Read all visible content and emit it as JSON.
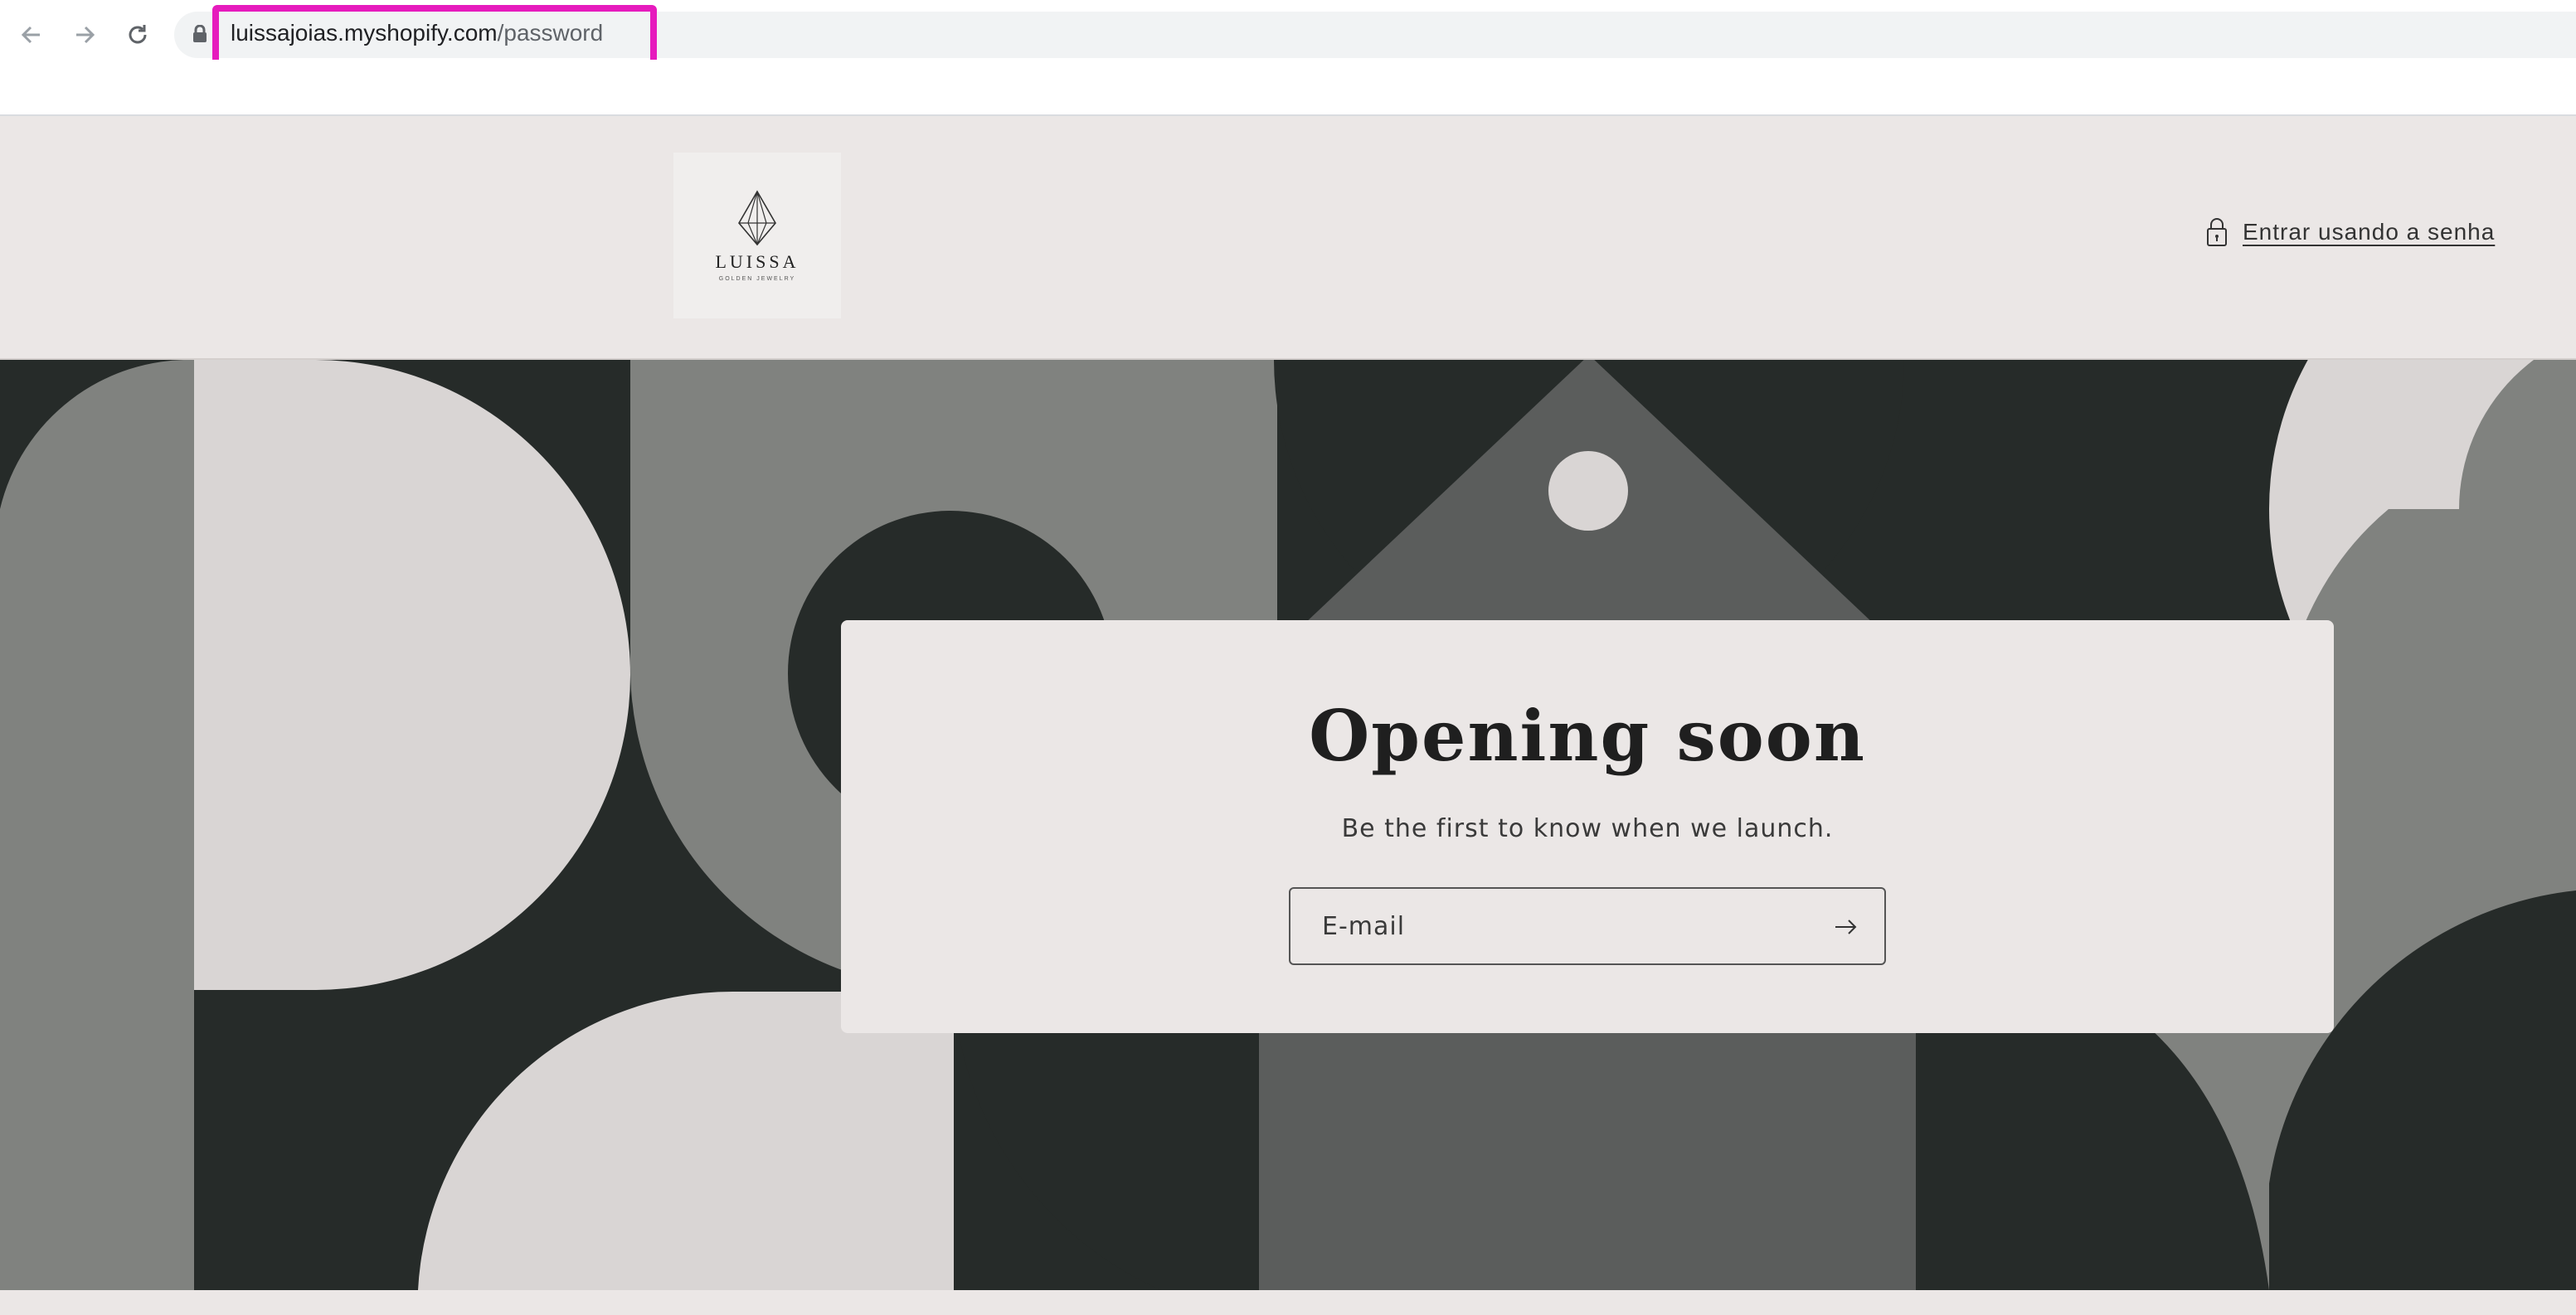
{
  "browser": {
    "url_domain": "luissajoias.myshopify.com",
    "url_path": "/password",
    "icons": [
      "back-arrow-icon",
      "forward-arrow-icon",
      "reload-icon",
      "lock-icon"
    ]
  },
  "header": {
    "logo_name": "LUISSA",
    "logo_tagline": "GOLDEN JEWELRY",
    "login_link": "Entrar usando a senha"
  },
  "main": {
    "heading": "Opening soon",
    "subtext": "Be the first to know when we launch.",
    "email_placeholder": "E-mail"
  },
  "colors": {
    "highlight": "#e61bbd",
    "background": "#ebe7e6",
    "dark": "#262b29",
    "gray": "#80827f",
    "mid": "#5b5d5c",
    "light": "#d9d5d4"
  }
}
